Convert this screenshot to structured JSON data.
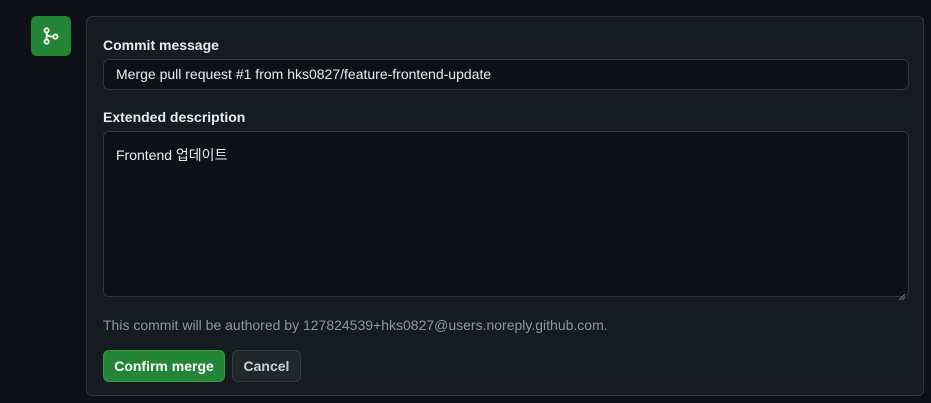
{
  "colors": {
    "page_background": "#0d1117",
    "panel_background": "#161b22",
    "border": "#30363d",
    "merge_green": "#238636",
    "text_primary": "#e6edf3",
    "text_muted": "#8d96a0"
  },
  "merge_icon": {
    "icon": "git-merge-icon"
  },
  "form": {
    "commit_message_label": "Commit message",
    "commit_message_value": "Merge pull request #1 from hks0827/feature-frontend-update",
    "extended_description_label": "Extended description",
    "extended_description_value": "Frontend 업데이트",
    "author_note": "This commit will be authored by 127824539+hks0827@users.noreply.github.com.",
    "confirm_label": "Confirm merge",
    "cancel_label": "Cancel"
  }
}
